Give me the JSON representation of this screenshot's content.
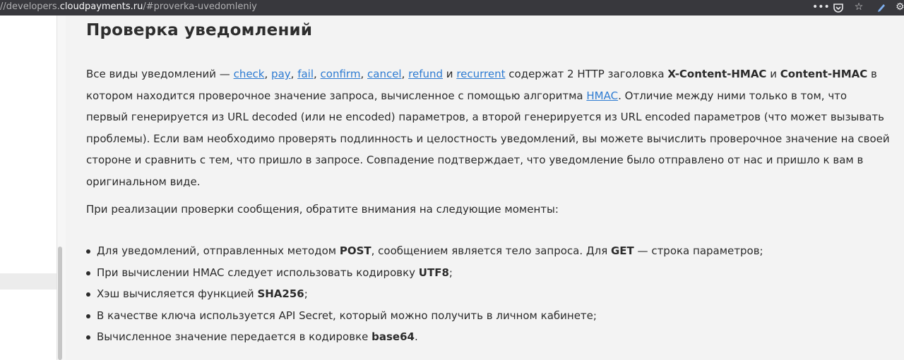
{
  "browser": {
    "url_prefix": "//developers.",
    "url_host": "cloudpayments.ru",
    "url_path": "/#proverka-uvedomleniy",
    "icons": [
      "more-icon",
      "pocket-icon",
      "bookmark-star-icon",
      "pen-icon",
      "extension-icon"
    ]
  },
  "page": {
    "title": "Проверка уведомлений",
    "intro": {
      "t1": "Все виды уведомлений — ",
      "links": [
        "check",
        "pay",
        "fail",
        "confirm",
        "cancel",
        "refund",
        "recurrent"
      ],
      "sep": ", ",
      "and": " и ",
      "t2": " содержат 2 HTTP заголовка ",
      "h1": "X-Content-HMAC",
      "t3": " и ",
      "h2": "Content-HMAC",
      "t4": " в котором находится проверочное значение запроса, вычисленное с помощью алгоритма ",
      "hmac_link": "HMAC",
      "t5": ". Отличие между ними только в том, что первый генерируется из URL decoded (или не encoded) параметров, а второй генерируется из URL encoded параметров (что может вызывать проблемы). Если вам необходимо проверять подлинность и целостность уведомлений, вы можете вычислить проверочное значение на своей стороне и сравнить с тем, что пришло в запросе. Совпадение подтверждает, что уведомление было отправлено от нас и пришло к вам в оригинальном виде."
    },
    "note": "При реализации проверки сообщения, обратите внимания на следующие моменты:",
    "bullets": [
      {
        "a": "Для уведомлений, отправленных методом ",
        "b": "POST",
        "c": ", сообщением является тело запроса. Для ",
        "d": "GET",
        "e": " — строка параметров;"
      },
      {
        "a": "При вычислении HMAC следует использовать кодировку ",
        "b": "UTF8",
        "c": ";"
      },
      {
        "a": "Хэш вычисляется функцией ",
        "b": "SHA256",
        "c": ";"
      },
      {
        "a": "В качестве ключа используется API Secret, который можно получить в личном кабинете;"
      },
      {
        "a": "Вычисленное значение передается в кодировке ",
        "b": "base64",
        "c": "."
      }
    ]
  }
}
